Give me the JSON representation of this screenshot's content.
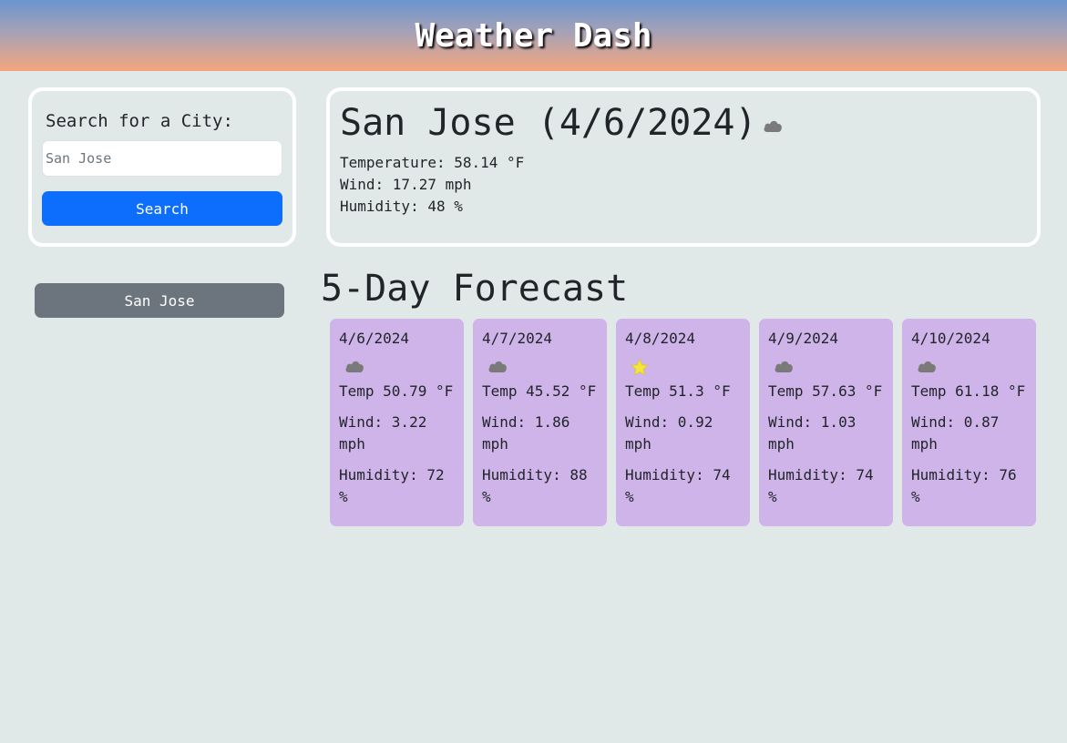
{
  "header": {
    "title": "Weather Dash"
  },
  "search": {
    "label": "Search for a City:",
    "input_value": "",
    "placeholder": "San Jose",
    "button_label": "Search"
  },
  "history": {
    "items": [
      {
        "label": "San Jose"
      }
    ]
  },
  "current": {
    "title": "San Jose (4/6/2024)",
    "icon": "cloud-icon",
    "temperature": "Temperature: 58.14 °F",
    "wind": "Wind: 17.27 mph",
    "humidity": "Humidity: 48 %"
  },
  "forecast": {
    "heading": "5-Day Forecast",
    "days": [
      {
        "date": "4/6/2024",
        "icon": "cloud-icon",
        "temp": "Temp 50.79 °F",
        "wind": "Wind: 3.22 mph",
        "humidity": "Humidity: 72 %"
      },
      {
        "date": "4/7/2024",
        "icon": "cloud-icon",
        "temp": "Temp 45.52 °F",
        "wind": "Wind: 1.86 mph",
        "humidity": "Humidity: 88 %"
      },
      {
        "date": "4/8/2024",
        "icon": "star-icon",
        "temp": "Temp 51.3 °F",
        "wind": "Wind: 0.92 mph",
        "humidity": "Humidity: 74 %"
      },
      {
        "date": "4/9/2024",
        "icon": "cloud-icon",
        "temp": "Temp 57.63 °F",
        "wind": "Wind: 1.03 mph",
        "humidity": "Humidity: 74 %"
      },
      {
        "date": "4/10/2024",
        "icon": "cloud-icon",
        "temp": "Temp 61.18 °F",
        "wind": "Wind: 0.87 mph",
        "humidity": "Humidity: 76 %"
      }
    ]
  },
  "colors": {
    "header_gradient_top": "#6a95cd",
    "header_gradient_bottom": "#f4a57e",
    "background": "#e1e9e8",
    "search_button": "#0d6efd",
    "history_button": "#6c757d",
    "forecast_card": "#cfb4ea",
    "cloud_icon": "#7a7a7a",
    "star_icon": "#f5e73a"
  }
}
